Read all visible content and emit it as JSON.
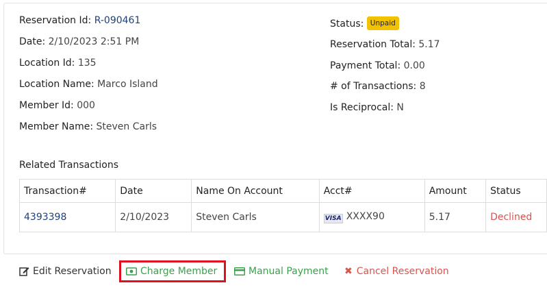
{
  "details_left": {
    "reservation_id_label": "Reservation Id:",
    "reservation_id": "R-090461",
    "date_label": "Date:",
    "date": "2/10/2023 2:51 PM",
    "location_id_label": "Location Id:",
    "location_id": "135",
    "location_name_label": "Location Name:",
    "location_name": "Marco Island",
    "member_id_label": "Member Id:",
    "member_id": "000",
    "member_name_label": "Member Name:",
    "member_name": "Steven Carls"
  },
  "details_right": {
    "status_label": "Status:",
    "status": "Unpaid",
    "reservation_total_label": "Reservation Total:",
    "reservation_total": "5.17",
    "payment_total_label": "Payment Total:",
    "payment_total": "0.00",
    "transactions_label": "# of Transactions:",
    "transactions": "8",
    "reciprocal_label": "Is Reciprocal:",
    "reciprocal": "N"
  },
  "transactions": {
    "title": "Related Transactions",
    "columns": [
      "Transaction#",
      "Date",
      "Name On Account",
      "Acct#",
      "Amount",
      "Status"
    ],
    "rows": [
      {
        "transaction": "4393398",
        "date": "2/10/2023",
        "name": "Steven Carls",
        "card_brand": "VISA",
        "acct": "XXXX90",
        "amount": "5.17",
        "status": "Declined"
      }
    ]
  },
  "actions": {
    "edit": "Edit Reservation",
    "charge": "Charge Member",
    "manual": "Manual Payment",
    "cancel": "Cancel Reservation"
  },
  "colors": {
    "link": "#1f3f7a",
    "success": "#3aa14b",
    "danger": "#d9534f",
    "badge": "#f2c200",
    "highlight": "#e0101e"
  },
  "icons": [
    "edit-icon",
    "money-bill-icon",
    "credit-card-icon",
    "times-icon",
    "visa-icon"
  ]
}
